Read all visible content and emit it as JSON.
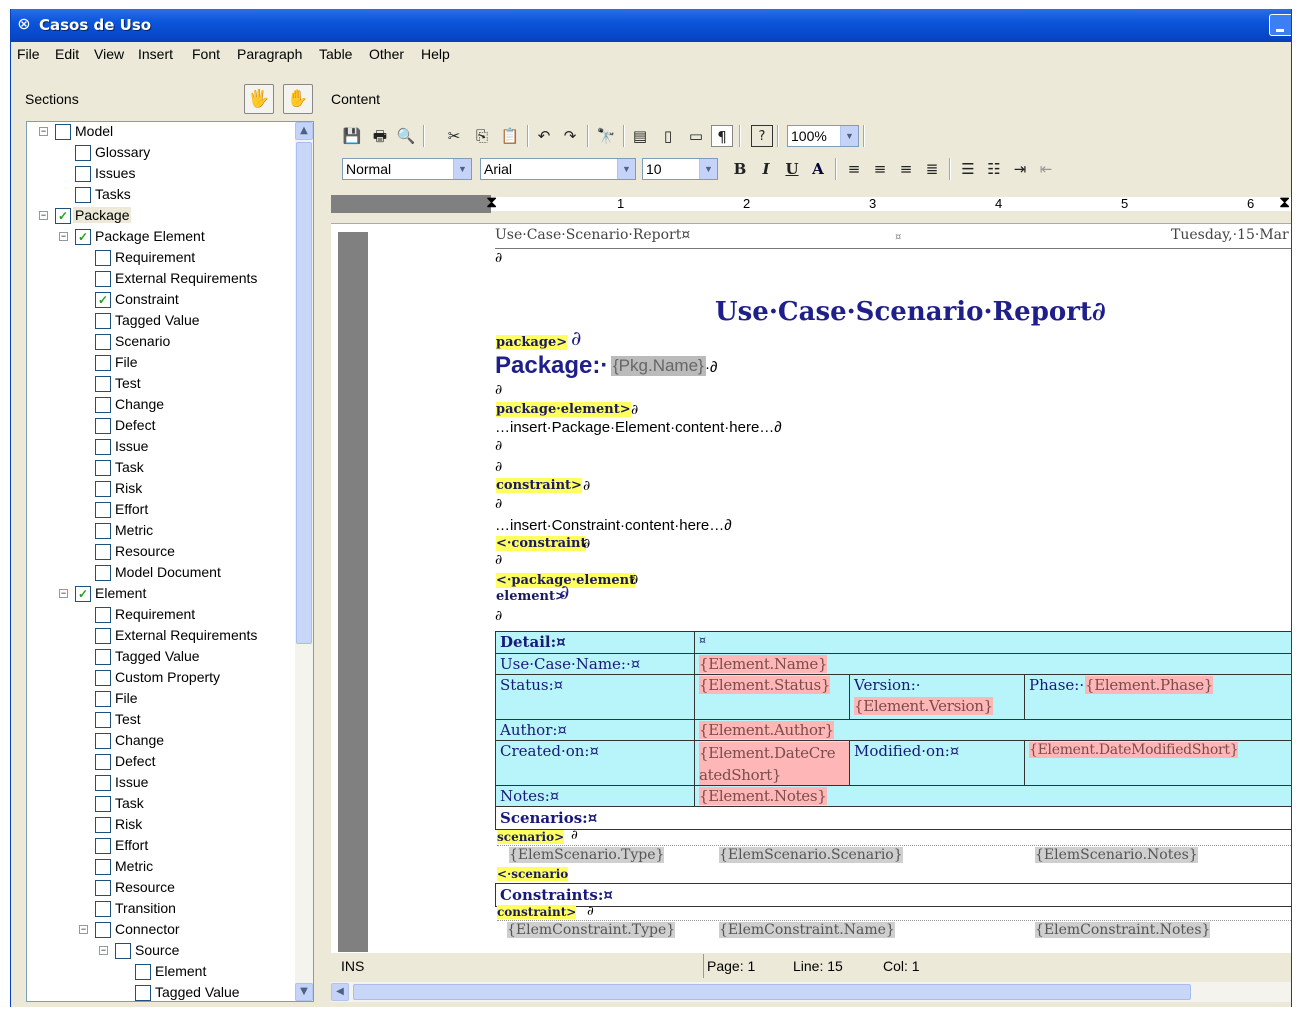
{
  "window": {
    "title": "Casos de Uso"
  },
  "menu": [
    "File",
    "Edit",
    "View",
    "Insert",
    "Font",
    "Paragraph",
    "Table",
    "Other",
    "Help"
  ],
  "panels": {
    "sections": "Sections",
    "content": "Content"
  },
  "tree": [
    {
      "label": "Model",
      "level": 0,
      "checked": false,
      "expander": "minus"
    },
    {
      "label": "Glossary",
      "level": 1,
      "checked": false
    },
    {
      "label": "Issues",
      "level": 1,
      "checked": false
    },
    {
      "label": "Tasks",
      "level": 1,
      "checked": false
    },
    {
      "label": "Package",
      "level": 0,
      "checked": true,
      "expander": "minus",
      "selected": true
    },
    {
      "label": "Package Element",
      "level": 1,
      "checked": true,
      "expander": "minus"
    },
    {
      "label": "Requirement",
      "level": 2,
      "checked": false
    },
    {
      "label": "External Requirements",
      "level": 2,
      "checked": false
    },
    {
      "label": "Constraint",
      "level": 2,
      "checked": true
    },
    {
      "label": "Tagged Value",
      "level": 2,
      "checked": false
    },
    {
      "label": "Scenario",
      "level": 2,
      "checked": false
    },
    {
      "label": "File",
      "level": 2,
      "checked": false
    },
    {
      "label": "Test",
      "level": 2,
      "checked": false
    },
    {
      "label": "Change",
      "level": 2,
      "checked": false
    },
    {
      "label": "Defect",
      "level": 2,
      "checked": false
    },
    {
      "label": "Issue",
      "level": 2,
      "checked": false
    },
    {
      "label": "Task",
      "level": 2,
      "checked": false
    },
    {
      "label": "Risk",
      "level": 2,
      "checked": false
    },
    {
      "label": "Effort",
      "level": 2,
      "checked": false
    },
    {
      "label": "Metric",
      "level": 2,
      "checked": false
    },
    {
      "label": "Resource",
      "level": 2,
      "checked": false
    },
    {
      "label": "Model Document",
      "level": 2,
      "checked": false
    },
    {
      "label": "Element",
      "level": 1,
      "checked": true,
      "expander": "minus"
    },
    {
      "label": "Requirement",
      "level": 2,
      "checked": false
    },
    {
      "label": "External Requirements",
      "level": 2,
      "checked": false
    },
    {
      "label": "Tagged Value",
      "level": 2,
      "checked": false
    },
    {
      "label": "Custom Property",
      "level": 2,
      "checked": false
    },
    {
      "label": "File",
      "level": 2,
      "checked": false
    },
    {
      "label": "Test",
      "level": 2,
      "checked": false
    },
    {
      "label": "Change",
      "level": 2,
      "checked": false
    },
    {
      "label": "Defect",
      "level": 2,
      "checked": false
    },
    {
      "label": "Issue",
      "level": 2,
      "checked": false
    },
    {
      "label": "Task",
      "level": 2,
      "checked": false
    },
    {
      "label": "Risk",
      "level": 2,
      "checked": false
    },
    {
      "label": "Effort",
      "level": 2,
      "checked": false
    },
    {
      "label": "Metric",
      "level": 2,
      "checked": false
    },
    {
      "label": "Resource",
      "level": 2,
      "checked": false
    },
    {
      "label": "Transition",
      "level": 2,
      "checked": false
    },
    {
      "label": "Connector",
      "level": 2,
      "checked": false,
      "expander": "minus"
    },
    {
      "label": "Source",
      "level": 3,
      "checked": false,
      "expander": "minus"
    },
    {
      "label": "Element",
      "level": 4,
      "checked": false
    },
    {
      "label": "Tagged Value",
      "level": 4,
      "checked": false
    }
  ],
  "toolbar": {
    "style": "Normal",
    "font": "Arial",
    "size": "10",
    "zoom": "100%",
    "bold": "B",
    "italic": "I",
    "underline": "U",
    "color": "A"
  },
  "ruler": [
    "1",
    "2",
    "3",
    "4",
    "5",
    "6"
  ],
  "document": {
    "header_left": "Use·Case·Scenario·Report¤",
    "header_mid": "¤",
    "header_right": "Tuesday,·15·Mar",
    "para1": "∂",
    "title": "Use·Case·Scenario·Report∂",
    "tag_package": "package>",
    "pkg_label": "Package:·",
    "pkg_field": "{Pkg.Name}",
    "pkg_after": "·∂",
    "tag_pkg_element": "package·element>",
    "insert_pkg_elem": "…insert·Package·Element·content·here…∂",
    "tag_constraint": "constraint>",
    "insert_constraint": "…insert·Constraint·content·here…∂",
    "tag_constraint_end": "<·constraint",
    "tag_pkg_element_end": "<·package·element",
    "tag_element": "element>",
    "detail": "Detail:¤",
    "detail_val": "¤",
    "use_case_name": "Use·Case·Name:·¤",
    "element_name": "{Element.Name}",
    "status": "Status:¤",
    "element_status": "{Element.Status}",
    "version": "Version:·",
    "element_version": "{Element.Version}",
    "phase": "Phase:·",
    "element_phase": "{Element.Phase}",
    "author": "Author:¤",
    "element_author": "{Element.Author}",
    "created_on": "Created·on:¤",
    "element_datecreated": "{Element.DateCre atedShort}",
    "modified_on": "Modified·on:¤",
    "element_datemodified": "{Element.DateModifiedShort}",
    "notes": "Notes:¤",
    "element_notes": "{Element.Notes}",
    "scenarios": "Scenarios:¤",
    "tag_scenario": "scenario>",
    "scn_type": "{ElemScenario.Type}",
    "scn_scenario": "{ElemScenario.Scenario}",
    "scn_notes": "{ElemScenario.Notes}",
    "tag_scenario_end": "<·scenario",
    "constraints": "Constraints:¤",
    "tag_constraint2": "constraint>",
    "con_type": "{ElemConstraint.Type}",
    "con_name": "{ElemConstraint.Name}",
    "con_notes": "{ElemConstraint.Notes}"
  },
  "status": {
    "mode": "INS",
    "page": "Page: 1",
    "line": "Line: 15",
    "col": "Col: 1"
  }
}
